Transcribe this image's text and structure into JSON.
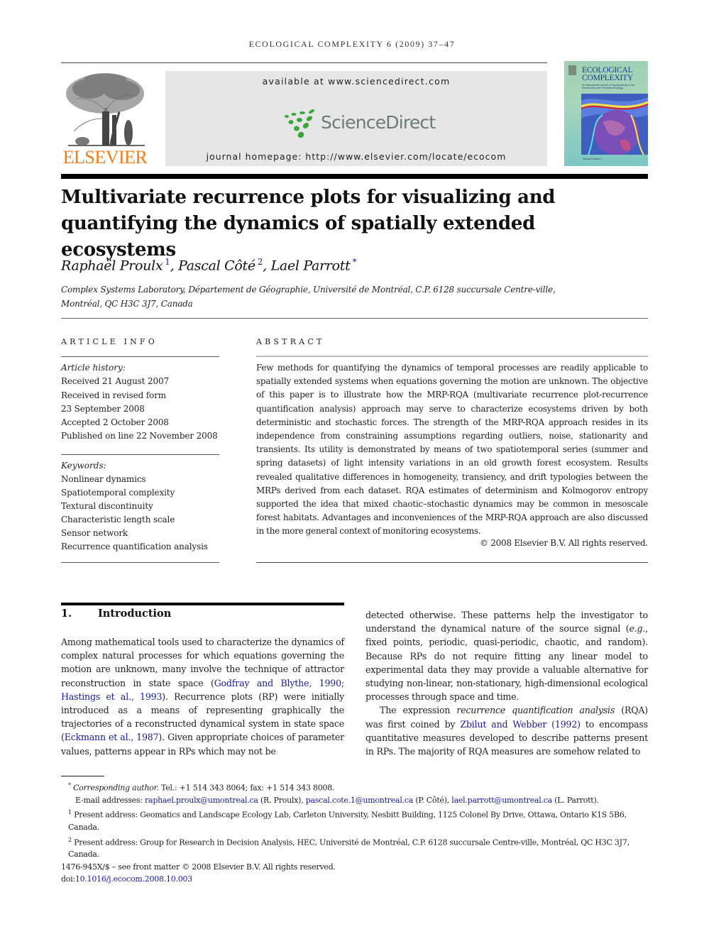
{
  "journal": {
    "running_head": "ECOLOGICAL COMPLEXITY 6 (2009) 37–47",
    "publisher_logo_text": "ELSEVIER",
    "available_at": "available at www.sciencedirect.com",
    "sciencedirect_logo_text": "ScienceDirect",
    "homepage": "journal homepage: http://www.elsevier.com/locate/ecocom",
    "cover": {
      "title_line1": "ECOLOGICAL",
      "title_line2": "COMPLEXITY",
      "subtitle": "An International Journal on Biocomplexity in the Environment and Theoretical Ecology"
    },
    "colors": {
      "elsevier_orange": "#f07d1a",
      "sciencedirect_green": "#3aa63a",
      "sciencedirect_grey": "#6d7a78",
      "banner_grey": "#e6e6e6",
      "link_blue": "#1a1aa0"
    }
  },
  "article": {
    "title": "Multivariate recurrence plots for visualizing and quantifying the dynamics of spatially extended ecosystems",
    "authors": [
      {
        "name": "Raphaël Proulx",
        "mark": "1"
      },
      {
        "name": "Pascal Côté",
        "mark": "2"
      },
      {
        "name": "Lael Parrott",
        "mark": "*"
      }
    ],
    "affiliation_line1": "Complex Systems Laboratory, Département de Géographie, Université de Montréal, C.P. 6128 succursale Centre-ville,",
    "affiliation_line2": "Montréal, QC H3C 3J7, Canada"
  },
  "article_info": {
    "heading": "ARTICLE INFO",
    "history_label": "Article history:",
    "history": [
      "Received 21 August 2007",
      "Received in revised form",
      "23 September 2008",
      "Accepted 2 October 2008",
      "Published on line 22 November 2008"
    ],
    "keywords_label": "Keywords:",
    "keywords": [
      "Nonlinear dynamics",
      "Spatiotemporal complexity",
      "Textural discontinuity",
      "Characteristic length scale",
      "Sensor network",
      "Recurrence quantification analysis"
    ]
  },
  "abstract": {
    "heading": "ABSTRACT",
    "text": "Few methods for quantifying the dynamics of temporal processes are readily applicable to spatially extended systems when equations governing the motion are unknown. The objective of this paper is to illustrate how the MRP-RQA (multivariate recurrence plot-recurrence quantification analysis) approach may serve to characterize ecosystems driven by both deterministic and stochastic forces. The strength of the MRP-RQA approach resides in its independence from constraining assumptions regarding outliers, noise, stationarity and transients. Its utility is demonstrated by means of two spatiotemporal series (summer and spring datasets) of light intensity variations in an old growth forest ecosystem. Results revealed qualitative differences in homogeneity, transiency, and drift typologies between the MRPs derived from each dataset. RQA estimates of determinism and Kolmogorov entropy supported the idea that mixed chaotic–stochastic dynamics may be common in mesoscale forest habitats. Advantages and inconveniences of the MRP-RQA approach are also discussed in the more general context of monitoring ecosystems.",
    "copyright": "© 2008 Elsevier B.V. All rights reserved."
  },
  "introduction": {
    "number": "1.",
    "heading": "Introduction",
    "p1_a": "Among mathematical tools used to characterize the dynamics of complex natural processes for which equations governing the motion are unknown, many involve the technique of attractor reconstruction in state space (",
    "p1_cite1": "Godfray and Blythe, 1990; Hastings et al., 1993",
    "p1_b": "). Recurrence plots (RP) were initially introduced as a means of representing graphically the trajectories of a reconstructed dynamical system in state space (",
    "p1_cite2": "Eckmann et al., 1987",
    "p1_c": "). Given appropriate choices of parameter values, patterns appear in RPs which may not be detected otherwise. These patterns help the investigator to understand the dynamical nature of the source signal (",
    "p1_eg": "e.g.",
    "p1_d": ", fixed points, periodic, quasi-periodic, chaotic, and random). Because RPs do not require fitting any linear model to experimental data they may provide a valuable alternative for studying non-linear, non-stationary, high-dimensional ecological processes through space and time.",
    "p2_a": "The expression ",
    "p2_term": "recurrence quantification analysis",
    "p2_b": " (RQA) was first coined by ",
    "p2_cite": "Zbilut and Webber (1992)",
    "p2_c": " to encompass quantitative measures developed to describe patterns present in RPs. The majority of RQA measures are somehow related to"
  },
  "footnotes": {
    "corr_mark": "*",
    "corr_label": "Corresponding author.",
    "corr_text": " Tel.: +1 514 343 8064; fax: +1 514 343 8008.",
    "email_label": "E-mail addresses: ",
    "emails": [
      {
        "address": "raphael.proulx@umontreal.ca",
        "who": " (R. Proulx), "
      },
      {
        "address": "pascal.cote.1@umontreal.ca",
        "who": " (P. Côté), "
      },
      {
        "address": "lael.parrott@umontreal.ca",
        "who": " (L. Parrott)."
      }
    ],
    "fn1_mark": "1",
    "fn1_text": " Present address: Geomatics and Landscape Ecology Lab, Carleton University, Nesbitt Building, 1125 Colonel By Drive, Ottawa, Ontario K1S 5B6, Canada.",
    "fn2_mark": "2",
    "fn2_text": " Present address: Group for Research in Decision Analysis, HEC, Université de Montréal, C.P. 6128 succursale Centre-ville, Montréal, QC H3C 3J7, Canada.",
    "issn_line": "1476-945X/$ – see front matter © 2008 Elsevier B.V. All rights reserved.",
    "doi_label": "doi:",
    "doi": "10.1016/j.ecocom.2008.10.003"
  }
}
